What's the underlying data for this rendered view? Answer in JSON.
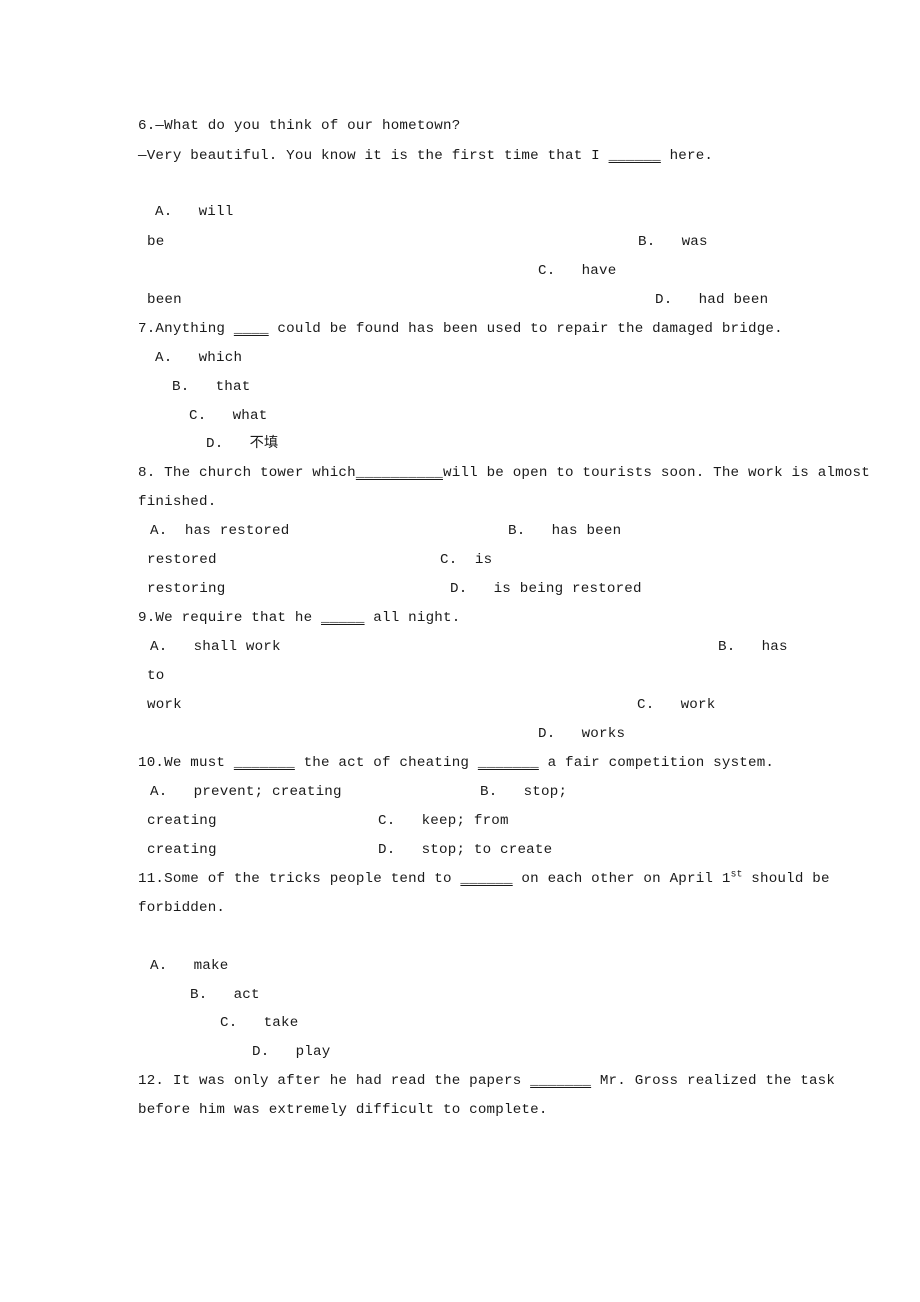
{
  "document": {
    "type": "english-grammar-multiple-choice-worksheet",
    "question_range": "6-12",
    "blank_marker": "______"
  },
  "questions": [
    {
      "number": "6.",
      "stem_lines": [
        "6.—What do you think of our hometown?",
        "—Very beautiful. You know it is the first time that I ______ here."
      ],
      "stem_line1": "6.—What do you think of our hometown?",
      "stem_line2_pre": "—Very beautiful. You know it is the first time that I ",
      "stem_line2_blank": "______",
      "stem_line2_post": " here.",
      "options": [
        {
          "label": "A.",
          "text": "will"
        },
        {
          "label": "",
          "text": "be"
        },
        {
          "label": "B.",
          "text": "was"
        },
        {
          "label": "C.",
          "text": "have"
        },
        {
          "label": "",
          "text": "been"
        },
        {
          "label": "D.",
          "text": "had been"
        }
      ]
    },
    {
      "number": "7.",
      "stem_pre": "7.Anything ",
      "stem_blank": "____",
      "stem_post": " could be found has been used to repair the damaged bridge.",
      "options": [
        {
          "label": "A.",
          "text": "which"
        },
        {
          "label": "B.",
          "text": "that"
        },
        {
          "label": "C.",
          "text": "what"
        },
        {
          "label": "D.",
          "text": "不填"
        }
      ]
    },
    {
      "number": "8.",
      "stem_pre": "8. The church tower which",
      "stem_blank": "__________",
      "stem_post": "will be open to tourists soon. The work is almost",
      "stem_line2": "finished.",
      "options": [
        {
          "label": "A.",
          "text": "has restored"
        },
        {
          "label": "B.",
          "text": "has been"
        },
        {
          "label": "",
          "text": "restored"
        },
        {
          "label": "C.",
          "text": "is"
        },
        {
          "label": "",
          "text": "restoring"
        },
        {
          "label": "D.",
          "text": "is being restored"
        }
      ]
    },
    {
      "number": "9.",
      "stem_pre": "9.We require that he ",
      "stem_blank": "_____",
      "stem_post": " all night.",
      "options": [
        {
          "label": "A.",
          "text": "shall work"
        },
        {
          "label": "B.",
          "text": "has"
        },
        {
          "label": "",
          "text": "to"
        },
        {
          "label": "",
          "text": "work"
        },
        {
          "label": "C.",
          "text": "work"
        },
        {
          "label": "D.",
          "text": "works"
        }
      ]
    },
    {
      "number": "10.",
      "stem_pre": "10.We must ",
      "stem_blank1": "_______",
      "stem_mid": " the act of cheating ",
      "stem_blank2": "_______",
      "stem_post": " a fair competition system.",
      "options": [
        {
          "label": "A.",
          "text": "prevent; creating"
        },
        {
          "label": "B.",
          "text": "stop;"
        },
        {
          "label": "",
          "text": "creating"
        },
        {
          "label": "C.",
          "text": "keep; from"
        },
        {
          "label": "",
          "text": "creating"
        },
        {
          "label": "D.",
          "text": "stop; to create"
        }
      ]
    },
    {
      "number": "11.",
      "stem_pre": "11.Some of the tricks people tend to ",
      "stem_blank": "______",
      "stem_mid": " on each other on April 1",
      "stem_sup": "st",
      "stem_post": " should be",
      "stem_line2": "forbidden.",
      "options": [
        {
          "label": "A.",
          "text": "make"
        },
        {
          "label": "B.",
          "text": "act"
        },
        {
          "label": "C.",
          "text": "take"
        },
        {
          "label": "D.",
          "text": "play"
        }
      ]
    },
    {
      "number": "12.",
      "stem_pre": "12. It was only after he had read the papers ",
      "stem_blank": "_______",
      "stem_post": " Mr. Gross realized the task",
      "stem_line2": "before him was extremely difficult to complete."
    }
  ]
}
